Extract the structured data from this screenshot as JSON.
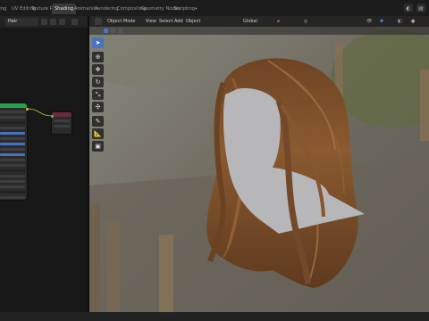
{
  "tabs": [
    {
      "label": "Sculpting",
      "active": false
    },
    {
      "label": "UV Editing",
      "active": false
    },
    {
      "label": "Texture Paint",
      "active": false
    },
    {
      "label": "Shading",
      "active": true
    },
    {
      "label": "Animation",
      "active": false
    },
    {
      "label": "Rendering",
      "active": false
    },
    {
      "label": "Compositing",
      "active": false
    },
    {
      "label": "Geometry Nodes",
      "active": false
    },
    {
      "label": "Scripting",
      "active": false
    },
    {
      "label": "+",
      "active": false
    }
  ],
  "node_editor": {
    "material_name": "Hair"
  },
  "viewport": {
    "mode": "Object Mode",
    "menu": [
      "View",
      "Select",
      "Add",
      "Object"
    ],
    "transform_orientation": "Global"
  },
  "tools": [
    {
      "icon": "select-cursor-icon",
      "glyph": "➤",
      "active": true
    },
    {
      "icon": "cursor-icon",
      "glyph": "⊕",
      "active": false
    },
    {
      "icon": "move-icon",
      "glyph": "✥",
      "active": false
    },
    {
      "icon": "rotate-icon",
      "glyph": "↻",
      "active": false
    },
    {
      "icon": "scale-icon",
      "glyph": "⤡",
      "active": false
    },
    {
      "icon": "transform-icon",
      "glyph": "✣",
      "active": false
    },
    {
      "icon": "annotate-icon",
      "glyph": "✎",
      "active": false
    },
    {
      "icon": "measure-icon",
      "glyph": "📐",
      "active": false
    },
    {
      "icon": "add-cube-icon",
      "glyph": "▣",
      "active": false
    }
  ],
  "colors": {
    "accent": "#4a72c2",
    "node_header_green": "#27a14e",
    "hair_brown": "#7a4e2a"
  }
}
